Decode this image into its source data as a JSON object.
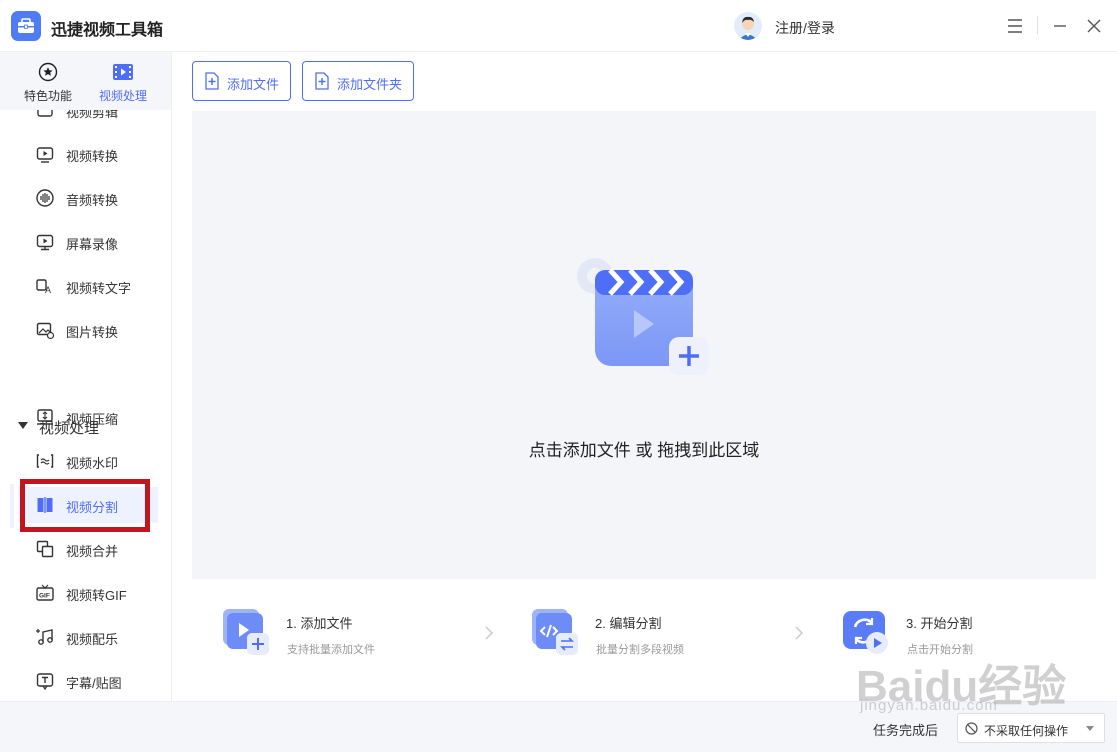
{
  "app": {
    "title": "迅捷视频工具箱",
    "login": "注册/登录"
  },
  "side_tabs": [
    {
      "label": "特色功能",
      "icon": "star-icon"
    },
    {
      "label": "视频处理",
      "icon": "film-icon"
    }
  ],
  "nav": {
    "partial_label": "视频剪辑",
    "items_top": [
      "视频转换",
      "音频转换",
      "屏幕录像",
      "视频转文字",
      "图片转换"
    ],
    "group_label": "视频处理",
    "items_group": [
      "视频压缩",
      "视频水印",
      "视频分割",
      "视频合并",
      "视频转GIF",
      "视频配乐",
      "字幕/贴图"
    ],
    "active": "视频分割"
  },
  "toolbar": {
    "add_file": "添加文件",
    "add_folder": "添加文件夹"
  },
  "dropzone": {
    "text": "点击添加文件 或 拖拽到此区域"
  },
  "steps": [
    {
      "title": "1. 添加文件",
      "desc": "支持批量添加文件"
    },
    {
      "title": "2. 编辑分割",
      "desc": "批量分割多段视频"
    },
    {
      "title": "3. 开始分割",
      "desc": "点击开始分割"
    }
  ],
  "footer": {
    "after_label": "任务完成后",
    "after_value": "不采取任何操作"
  },
  "watermark": {
    "main": "Baidu经验",
    "sub": "jingyan.baidu.com"
  },
  "colors": {
    "accent": "#4f6ef7",
    "highlight": "#c0161d",
    "panel": "#f4f5f8"
  }
}
